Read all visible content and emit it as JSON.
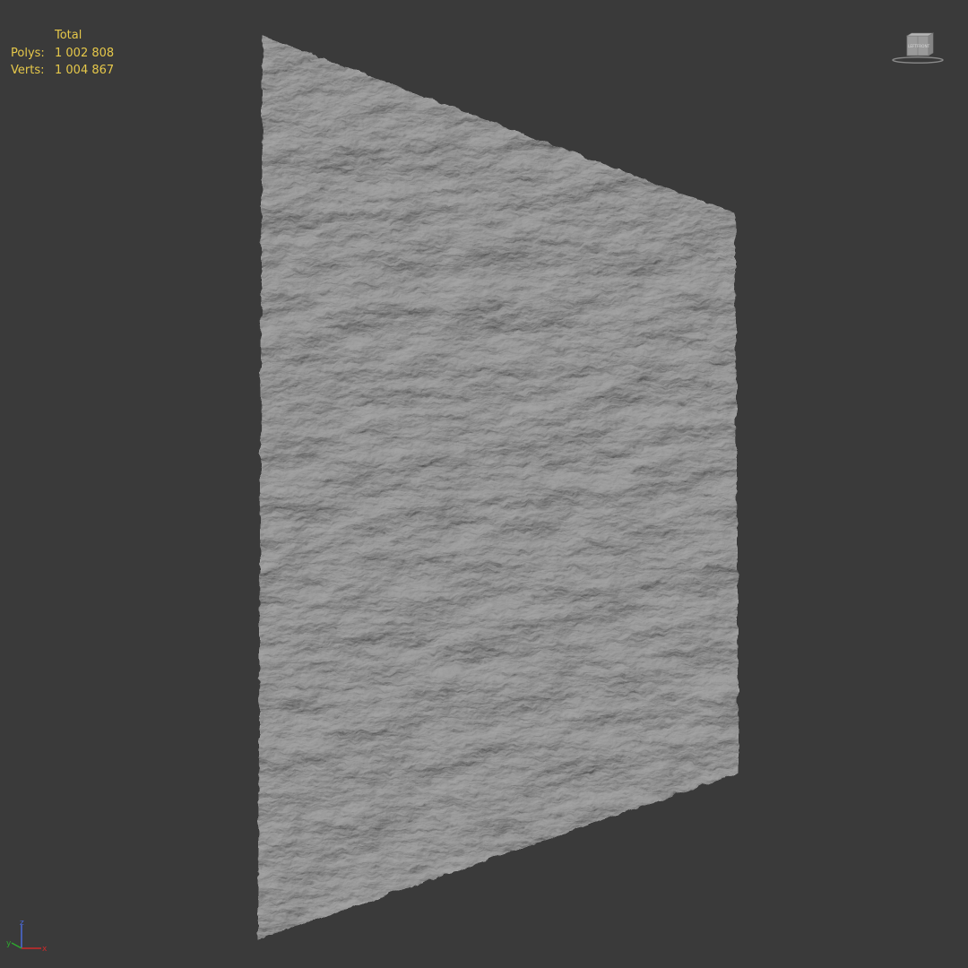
{
  "stats": {
    "header": "Total",
    "polys_label": "Polys:",
    "polys_value": "1 002 808",
    "verts_label": "Verts:",
    "verts_value": "1 004 867"
  },
  "viewcube": {
    "left_face": "LEFT",
    "front_face": "FRONT"
  },
  "axis": {
    "x_label": "x",
    "y_label": "y",
    "z_label": "z",
    "x_color": "#cc2a2a",
    "y_color": "#2ea82e",
    "z_color": "#4a6ad8"
  },
  "colors": {
    "viewport_background": "#3a3a3a",
    "stats_text": "#e6c84a",
    "mesh_surface": "#b9b9b9"
  },
  "icons": [
    "viewcube-icon",
    "axis-tripod-icon"
  ]
}
